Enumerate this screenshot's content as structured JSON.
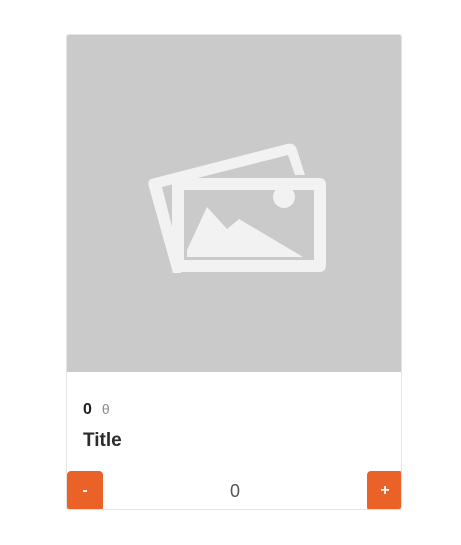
{
  "product": {
    "image_icon": "image-placeholder-icon",
    "price": "0",
    "currency": "θ",
    "title": "Title"
  },
  "stepper": {
    "decrement_label": "-",
    "quantity": "0",
    "increment_label": "+"
  },
  "colors": {
    "accent": "#ea6228",
    "placeholder_bg": "#cacaca",
    "placeholder_icon": "#f2f2f2"
  }
}
